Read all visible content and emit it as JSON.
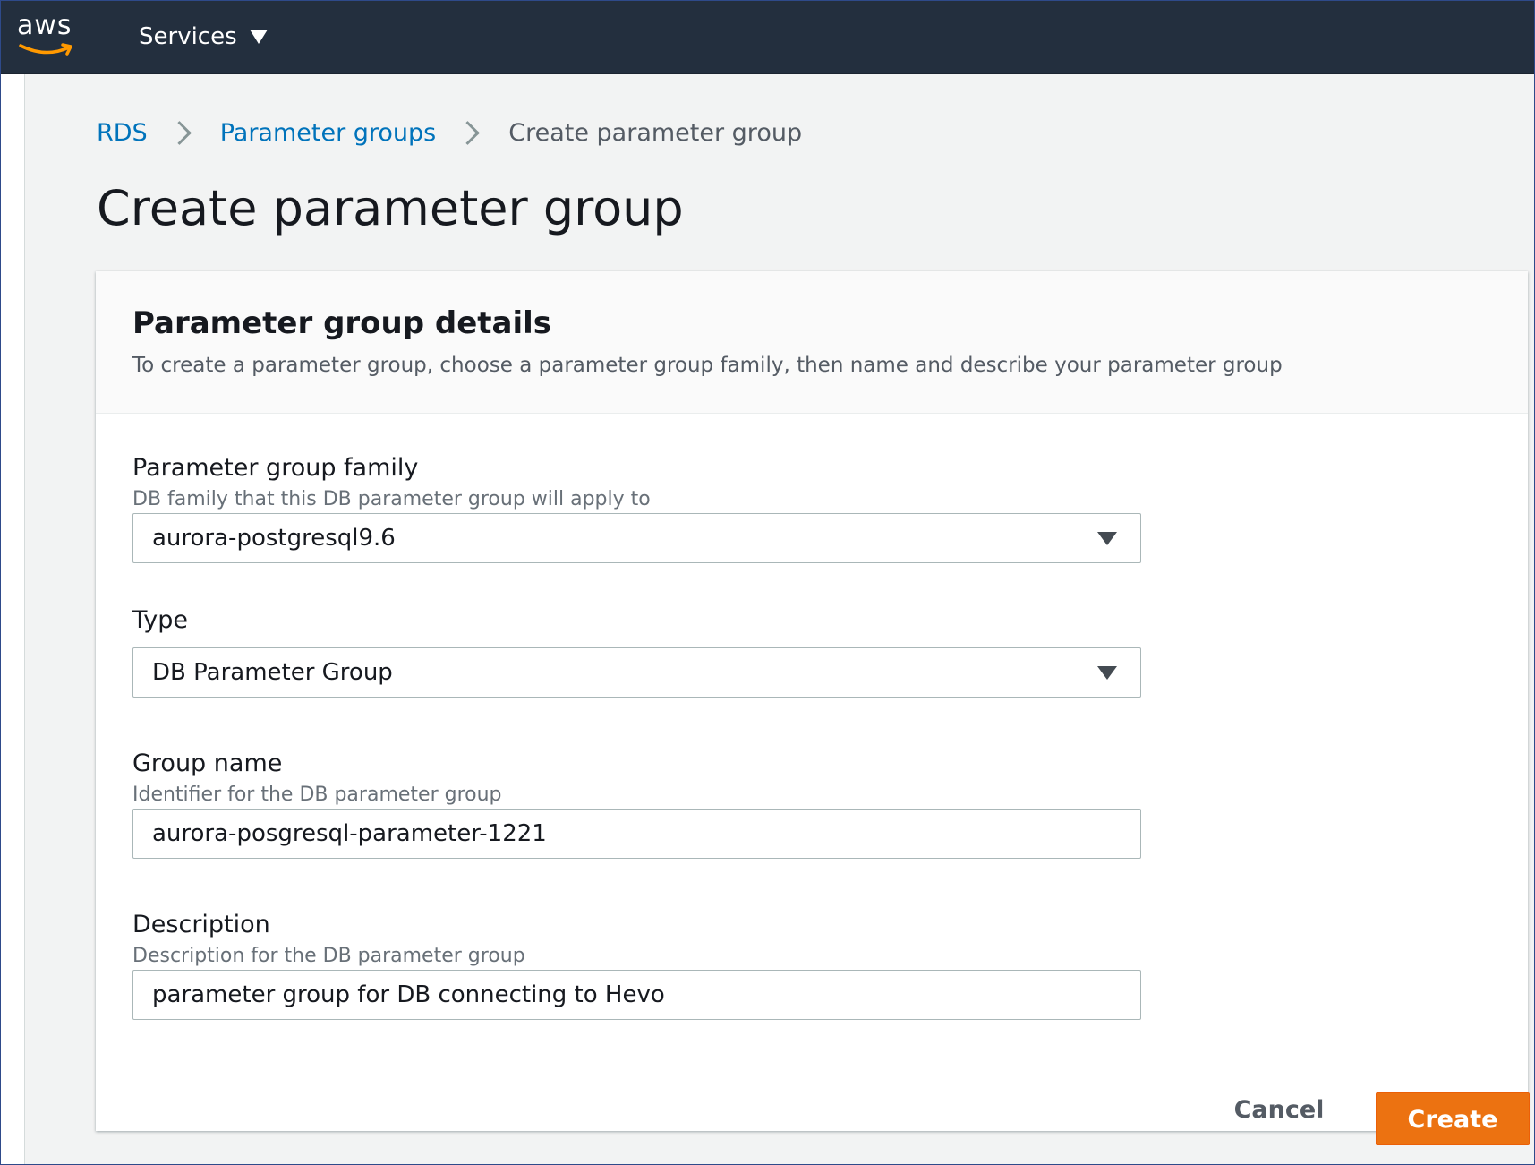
{
  "nav": {
    "logo_text": "aws",
    "services_label": "Services",
    "services_icon": "caret-down-icon"
  },
  "breadcrumb": {
    "items": [
      "RDS",
      "Parameter groups"
    ],
    "current": "Create parameter group",
    "separator_icon": "chevron-right-icon"
  },
  "page": {
    "title": "Create parameter group"
  },
  "panel": {
    "title": "Parameter group details",
    "description": "To create a parameter group, choose a parameter group family, then name and describe your parameter group"
  },
  "fields": {
    "family": {
      "label": "Parameter group family",
      "hint": "DB family that this DB parameter group will apply to",
      "value": "aurora-postgresql9.6"
    },
    "type": {
      "label": "Type",
      "value": "DB Parameter Group"
    },
    "group_name": {
      "label": "Group name",
      "hint": "Identifier for the DB parameter group",
      "value": "aurora-posgresql-parameter-1221"
    },
    "description": {
      "label": "Description",
      "hint": "Description for the DB parameter group",
      "value": "parameter group for DB connecting to Hevo"
    }
  },
  "actions": {
    "cancel_label": "Cancel",
    "create_label": "Create"
  },
  "colors": {
    "nav_bg": "#232f3e",
    "link": "#0073bb",
    "primary_button": "#ec7211",
    "page_bg": "#f2f3f3"
  }
}
